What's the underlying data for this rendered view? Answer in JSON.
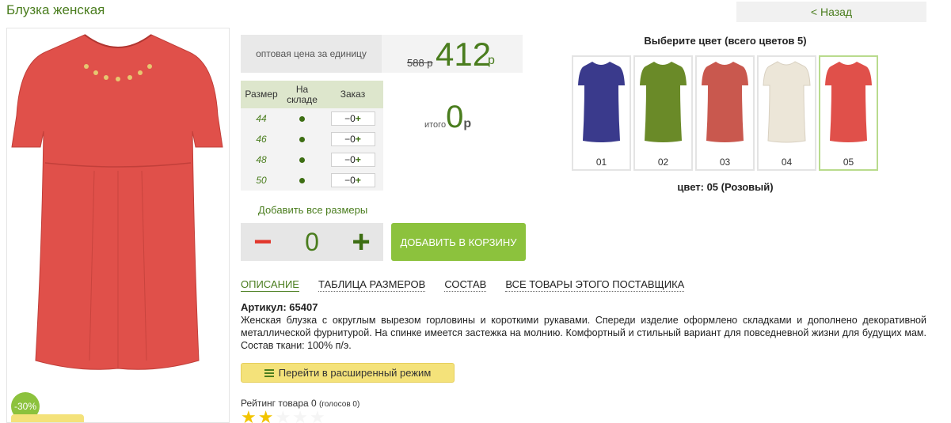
{
  "header": {
    "title": "Блузка женская",
    "back_label": "< Назад"
  },
  "product": {
    "discount_badge": "-30%",
    "price_label": "оптовая цена за единицу",
    "old_price": "588 р",
    "new_price": "412",
    "currency": "р",
    "color_hex": "#e0504a"
  },
  "size_table": {
    "headers": [
      "Размер",
      "На складе",
      "Заказ"
    ],
    "rows": [
      {
        "size": "44",
        "qty": "0",
        "minus": "−",
        "plus": "+"
      },
      {
        "size": "46",
        "qty": "0",
        "minus": "−",
        "plus": "+"
      },
      {
        "size": "48",
        "qty": "0",
        "minus": "−",
        "plus": "+"
      },
      {
        "size": "50",
        "qty": "0",
        "minus": "−",
        "plus": "+"
      }
    ]
  },
  "total": {
    "label": "итого",
    "value": "0",
    "currency": "р"
  },
  "add_all_label": "Добавить все размеры",
  "quantity": {
    "minus": "−",
    "value": "0",
    "plus": "+"
  },
  "cart_button_label": "ДОБАВИТЬ В КОРЗИНУ",
  "tabs": [
    {
      "label": "ОПИСАНИЕ",
      "active": true
    },
    {
      "label": "ТАБЛИЦА РАЗМЕРОВ",
      "active": false
    },
    {
      "label": "СОСТАВ",
      "active": false
    },
    {
      "label": "ВСЕ ТОВАРЫ ЭТОГО ПОСТАВЩИКА",
      "active": false
    }
  ],
  "article": "Артикул: 65407",
  "description": "Женская блузка с округлым вырезом горловины и короткими рукавами. Спереди изделие оформлено складками и дополнено декоративной металлической фурнитурой. На спинке  имеется застежка на молнию. Комфортный и стильный вариант для повседневной жизни для будущих мам. Состав ткани: 100% п/э.",
  "advanced_mode_label": "Перейти в расширенный режим",
  "rating": {
    "text": "Рейтинг товара 0",
    "votes": "(голосов 0)",
    "stars": 2
  },
  "colors": {
    "title": "Выберите цвет (всего цветов 5)",
    "selected_label": "цвет: 05 (Розовый)",
    "items": [
      {
        "num": "01",
        "hex": "#3a3a8c",
        "active": false
      },
      {
        "num": "02",
        "hex": "#6a8a28",
        "active": false
      },
      {
        "num": "03",
        "hex": "#c9584e",
        "active": false
      },
      {
        "num": "04",
        "hex": "#ece6d8",
        "active": false
      },
      {
        "num": "05",
        "hex": "#e0504a",
        "active": true
      }
    ]
  }
}
